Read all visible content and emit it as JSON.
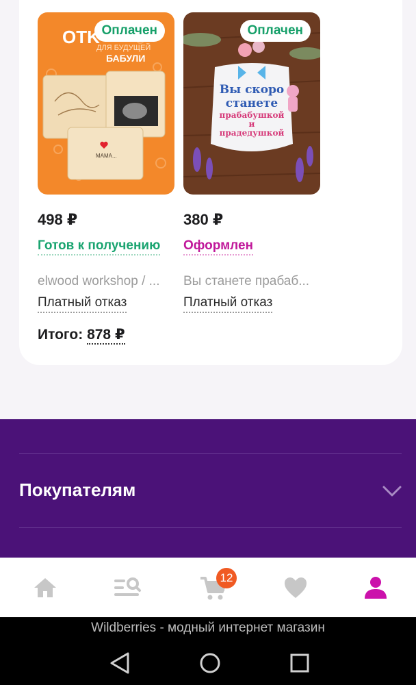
{
  "order": {
    "products": [
      {
        "badge": "Оплачен",
        "price": "498 ₽",
        "status": "Готов к получению",
        "seller": "elwood workshop / ...",
        "refusal": "Платный отказ",
        "image_text": {
          "brand": "OTK",
          "line1": "ДЛЯ БУДУЩЕЙ",
          "line2": "БАБУЛИ",
          "plate": "МАМА..."
        }
      },
      {
        "badge": "Оплачен",
        "price": "380 ₽",
        "status": "Оформлен",
        "seller": "Вы станете прабаб...",
        "refusal": "Платный отказ",
        "image_text": {
          "l1": "Вы скоро",
          "l2": "станете",
          "l3": "прабабушкой",
          "l4": "и",
          "l5": "прадедушкой"
        }
      }
    ],
    "total_label": "Итого:",
    "total_amount": "878 ₽"
  },
  "footer": {
    "section_title": "Покупателям"
  },
  "tabbar": {
    "items": [
      "home-icon",
      "catalog-search-icon",
      "cart-icon",
      "heart-icon",
      "profile-icon"
    ],
    "cart_count": "12",
    "active_color": "#cb11ab",
    "inactive_color": "#c7c7c7"
  },
  "system": {
    "window_title": "Wildberries - модный интернет магазин"
  },
  "colors": {
    "footer_bg": "#4b1278",
    "paid": "#17a06a",
    "ready": "#1aa470",
    "formed": "#c0179a",
    "badge": "#f05a23"
  }
}
